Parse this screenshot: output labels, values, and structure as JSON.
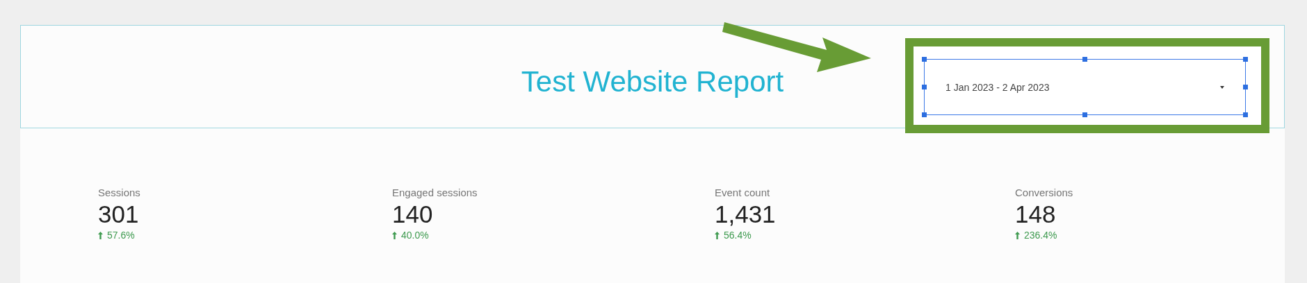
{
  "report": {
    "title": "Test Website Report"
  },
  "date_range": {
    "value": "1 Jan 2023 - 2 Apr 2023",
    "selected": true,
    "highlighted": true
  },
  "metrics": [
    {
      "label": "Sessions",
      "value": "301",
      "increase": true,
      "change": "57.6%"
    },
    {
      "label": "Engaged sessions",
      "value": "140",
      "increase": true,
      "change": "40.0%"
    },
    {
      "label": "Event count",
      "value": "1,431",
      "increase": true,
      "change": "56.4%"
    },
    {
      "label": "Conversions",
      "value": "148",
      "increase": true,
      "change": "236.4%"
    }
  ]
}
